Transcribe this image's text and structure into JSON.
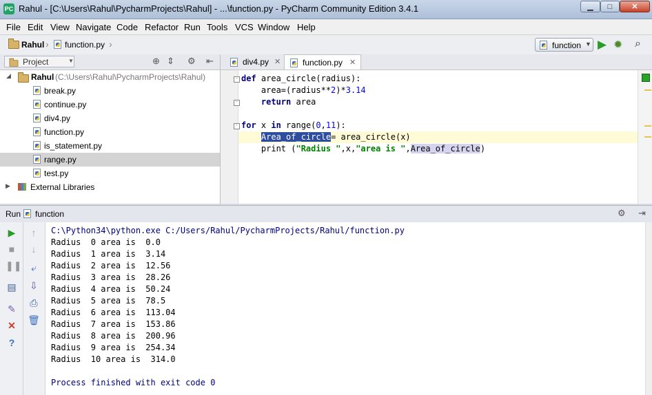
{
  "window": {
    "title": "Rahul - [C:\\Users\\Rahul\\PycharmProjects\\Rahul] - ...\\function.py - PyCharm Community Edition 3.4.1",
    "app_icon": "PC",
    "minimize": "▁",
    "maximize": "□",
    "close": "✕"
  },
  "menu": [
    "File",
    "Edit",
    "View",
    "Navigate",
    "Code",
    "Refactor",
    "Run",
    "Tools",
    "VCS",
    "Window",
    "Help"
  ],
  "navbar": {
    "crumbs": [
      "Rahul",
      "function.py"
    ],
    "run_config": "function",
    "run_icon": "▶",
    "debug_icon": "✹",
    "search_icon": "⌕"
  },
  "project": {
    "combo_label": "Project",
    "root_name": "Rahul",
    "root_path": "(C:\\Users\\Rahul\\PycharmProjects\\Rahul)",
    "files": [
      "break.py",
      "continue.py",
      "div4.py",
      "function.py",
      "is_statement.py",
      "range.py",
      "test.py"
    ],
    "selected_file": "range.py",
    "external": "External Libraries"
  },
  "editor": {
    "tabs": [
      "div4.py",
      "function.py"
    ],
    "active_tab": "function.py",
    "code": {
      "l1_kw": "def",
      "l1_rest": " area_circle(radius):",
      "l2_pre": "    area=(radius**",
      "l2_n1": "2",
      "l2_mid": ")*",
      "l2_n2": "3.14",
      "l3_kw": "return",
      "l3_rest": " area",
      "l5_kw1": "for",
      "l5_a": " x ",
      "l5_kw2": "in",
      "l5_b": " range(",
      "l5_n1": "0",
      "l5_c": ",",
      "l5_n2": "11",
      "l5_d": "):",
      "l6_var": "Area_of_circle",
      "l6_rest": "= area_circle(x)",
      "l7_a": "    print (",
      "l7_s1": "\"Radius \"",
      "l7_b": ",x,",
      "l7_s2": "\"area is \"",
      "l7_c": ",",
      "l7_var": "Area_of_circle",
      "l7_d": ")"
    }
  },
  "run": {
    "label": "Run",
    "config": "function",
    "command": "C:\\Python34\\python.exe C:/Users/Rahul/PycharmProjects/Rahul/function.py",
    "output": [
      "Radius  0 area is  0.0",
      "Radius  1 area is  3.14",
      "Radius  2 area is  12.56",
      "Radius  3 area is  28.26",
      "Radius  4 area is  50.24",
      "Radius  5 area is  78.5",
      "Radius  6 area is  113.04",
      "Radius  7 area is  153.86",
      "Radius  8 area is  200.96",
      "Radius  9 area is  254.34",
      "Radius  10 area is  314.0"
    ],
    "exit_message": "Process finished with exit code 0"
  }
}
